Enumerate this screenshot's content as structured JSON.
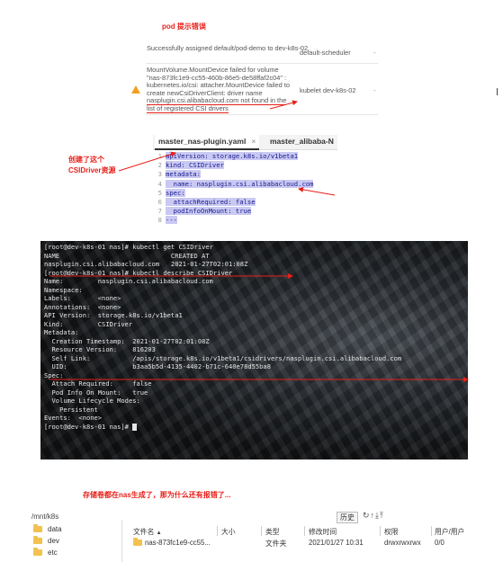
{
  "title_note": "pod 提示错误",
  "events": [
    {
      "message": "Successfully assigned default/pod-demo to dev-k8s-02",
      "source": "default-scheduler",
      "count": "-"
    },
    {
      "message_lines": [
        "MountVolume.MountDevice failed for volume",
        "\"nas-873fc1e9-cc55-460b-86e5-de58ffaf2c04\" :",
        "kubernetes.io/csi: attacher.MountDevice failed to",
        "create newCsiDriverClient: driver name",
        "nasplugin.csi.alibabacloud.com not found in the",
        "list of registered CSI drivers"
      ],
      "source": "kubelet dev-k8s-02",
      "count": "-",
      "icon": "warning-icon"
    }
  ],
  "side_note": {
    "line1": "创建了这个",
    "line2": "CSIDriver资源"
  },
  "editor": {
    "tabs": [
      {
        "label": "master_nas-plugin.yaml",
        "close": "×"
      },
      {
        "label": "master_alibaba-N"
      }
    ],
    "lines": [
      {
        "n": "1",
        "text": "apiVersion: storage.k8s.io/v1beta1"
      },
      {
        "n": "2",
        "text": "kind: CSIDriver"
      },
      {
        "n": "3",
        "text": "metadata:"
      },
      {
        "n": "4",
        "text": "  name: nasplugin.csi.alibabacloud.com"
      },
      {
        "n": "5",
        "text": "spec:"
      },
      {
        "n": "6",
        "text": "  attachRequired: false"
      },
      {
        "n": "7",
        "text": "  podInfoOnMount: true"
      },
      {
        "n": "8",
        "text": "---"
      }
    ]
  },
  "terminal": {
    "lines": [
      "[root@dev-k8s-01 nas]# kubectl get CSIDriver",
      "NAME                             CREATED AT",
      "nasplugin.csi.alibabacloud.com   2021-01-27T02:01:08Z",
      "[root@dev-k8s-01 nas]# kubectl describe CSIDriver",
      "Name:         nasplugin.csi.alibabacloud.com",
      "Namespace:",
      "Labels:       <none>",
      "Annotations:  <none>",
      "API Version:  storage.k8s.io/v1beta1",
      "Kind:         CSIDriver",
      "Metadata:",
      "  Creation Timestamp:  2021-01-27T02:01:08Z",
      "  Resource Version:    816203",
      "  Self Link:           /apis/storage.k8s.io/v1beta1/csidrivers/nasplugin.csi.alibabacloud.com",
      "  UID:                 b3aa5b5d-4135-4402-b71c-640e78d55ba8",
      "Spec:",
      "  Attach Required:     false",
      "  Pod Info On Mount:   true",
      "  Volume Lifecycle Modes:",
      "    Persistent",
      "Events:  <none>",
      "[root@dev-k8s-01 nas]# "
    ]
  },
  "question_note": "存储卷都在nas生成了，那为什么还有报错了...",
  "file_manager": {
    "path": "/mnt/k8s",
    "history_button": "历史",
    "toolbar_icons": [
      "refresh-icon",
      "upload-icon",
      "download-icon",
      "upload-folder-icon"
    ],
    "tree": [
      "data",
      "dev",
      "etc"
    ],
    "columns": [
      "文件名",
      "大小",
      "类型",
      "修改时间",
      "权限",
      "用户/用户"
    ],
    "sort_indicator": "▲",
    "rows": [
      {
        "name": "nas-873fc1e9-cc55...",
        "size": "",
        "type": "文件夹",
        "modified": "2021/01/27 10:31",
        "perms": "drwxrwxrwx",
        "owner": "0/0"
      }
    ]
  },
  "colors": {
    "annotation": "#e8201a",
    "highlight": "#c9c9f3",
    "folder": "#f2c24f",
    "warning": "#f0a020"
  }
}
